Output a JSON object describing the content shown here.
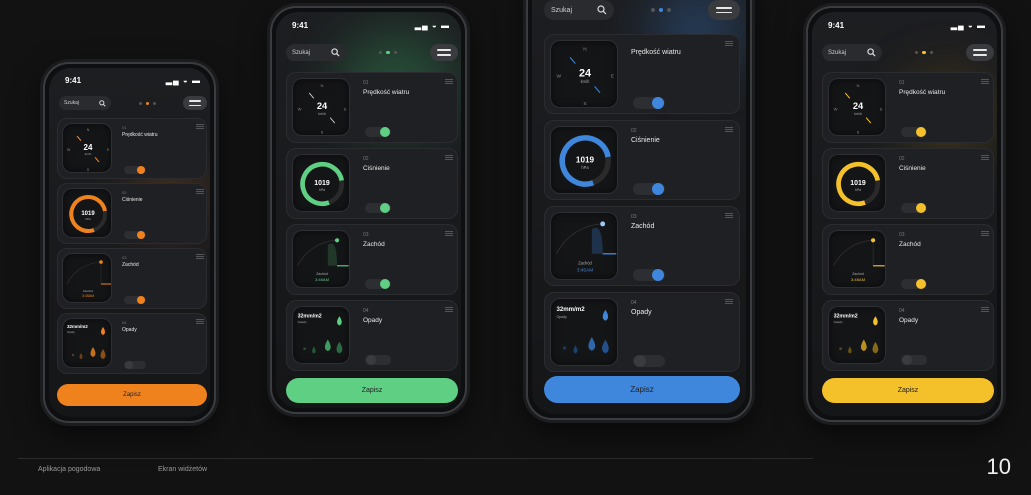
{
  "status_time": "9:41",
  "search_label": "Szukaj",
  "widgets": [
    {
      "num": "01",
      "title": "Prędkość wiatru"
    },
    {
      "num": "02",
      "title": "Ciśnienie"
    },
    {
      "num": "03",
      "title": "Zachód"
    },
    {
      "num": "04",
      "title": "Opady"
    }
  ],
  "wind_value": "24",
  "wind_unit": "km/h",
  "compass": {
    "n": "N",
    "s": "S",
    "w": "W",
    "e": "E"
  },
  "pressure_value": "1019",
  "pressure_unit": "hPa",
  "sunset_label": "Zachód",
  "sunset_time": "3:45AM",
  "rain_value": "32mm/m2",
  "rain_label": "Opady",
  "save_label": "Zapisz",
  "footer": {
    "left": "Aplikacja pogodowa",
    "middle": "Ekran widżetów",
    "page": "10"
  },
  "accents": {
    "orange": "#f0821e",
    "green": "#5fcf84",
    "blue": "#3f87dc",
    "yellow": "#f5c12a"
  }
}
